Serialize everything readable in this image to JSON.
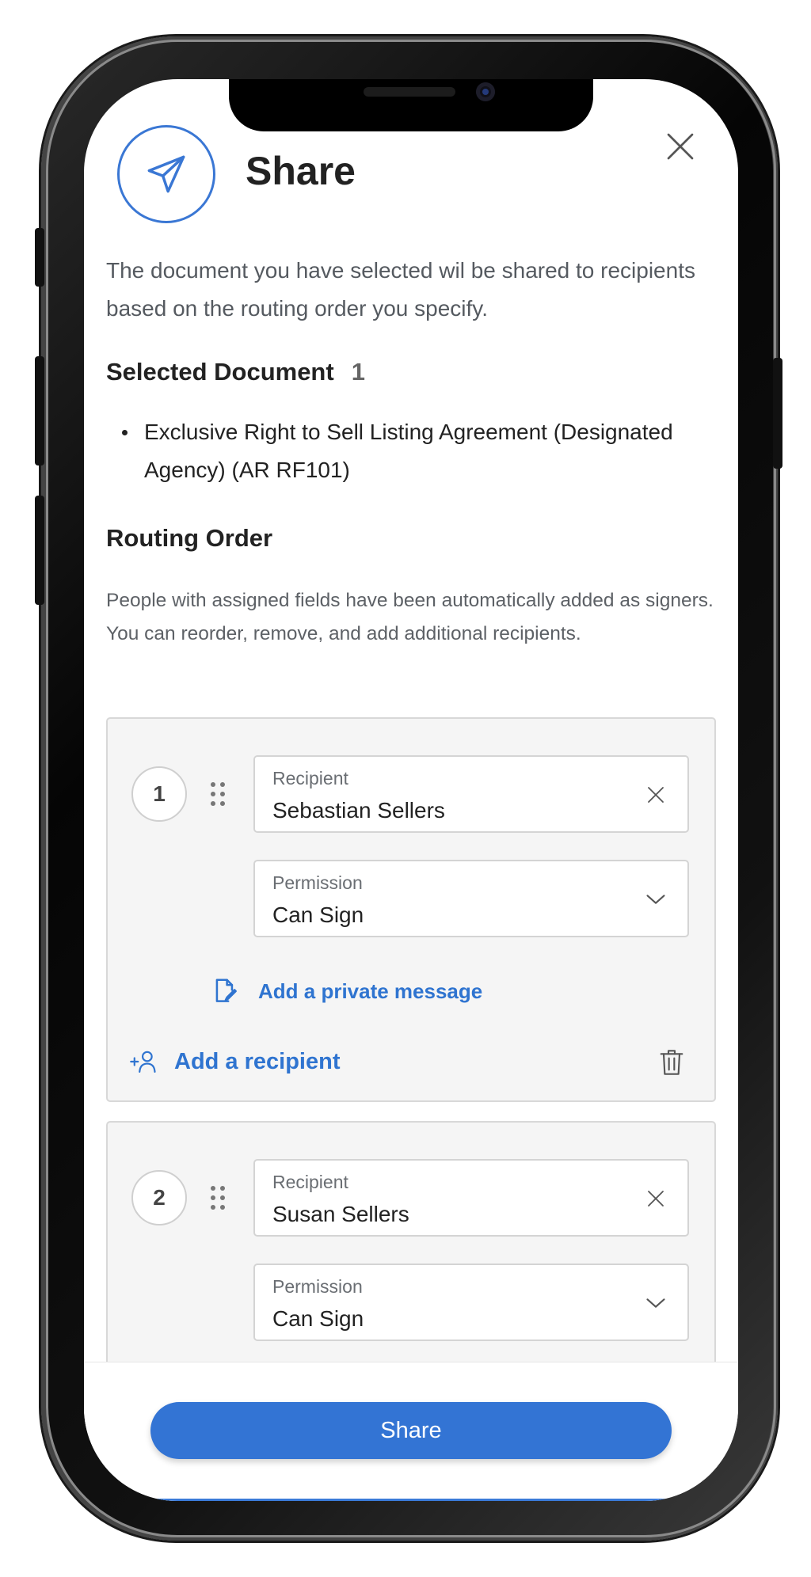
{
  "header": {
    "title": "Share",
    "share_icon": "paper-plane-icon",
    "close_icon": "close-icon"
  },
  "intro": "The document you have selected wil be  shared to recipients based on the routing order you specify.",
  "selected_document": {
    "heading": "Selected Document",
    "count": "1",
    "items": [
      "Exclusive Right to Sell Listing Agreement (Designated Agency) (AR RF101)"
    ]
  },
  "routing": {
    "heading": "Routing Order",
    "description": "People with assigned fields have been automatically added as signers. You can reorder, remove, and add additional recipients.",
    "recipients": [
      {
        "order": "1",
        "recipient_label": "Recipient",
        "recipient_value": "Sebastian Sellers",
        "permission_label": "Permission",
        "permission_value": "Can Sign",
        "private_message_label": "Add a private message",
        "add_recipient_label": "Add a recipient"
      },
      {
        "order": "2",
        "recipient_label": "Recipient",
        "recipient_value": "Susan Sellers",
        "permission_label": "Permission",
        "permission_value": "Can Sign"
      }
    ]
  },
  "footer": {
    "share_label": "Share"
  },
  "colors": {
    "accent": "#3374d4",
    "link": "#2f74d0",
    "card_bg": "#f5f5f5",
    "text": "#222222"
  }
}
